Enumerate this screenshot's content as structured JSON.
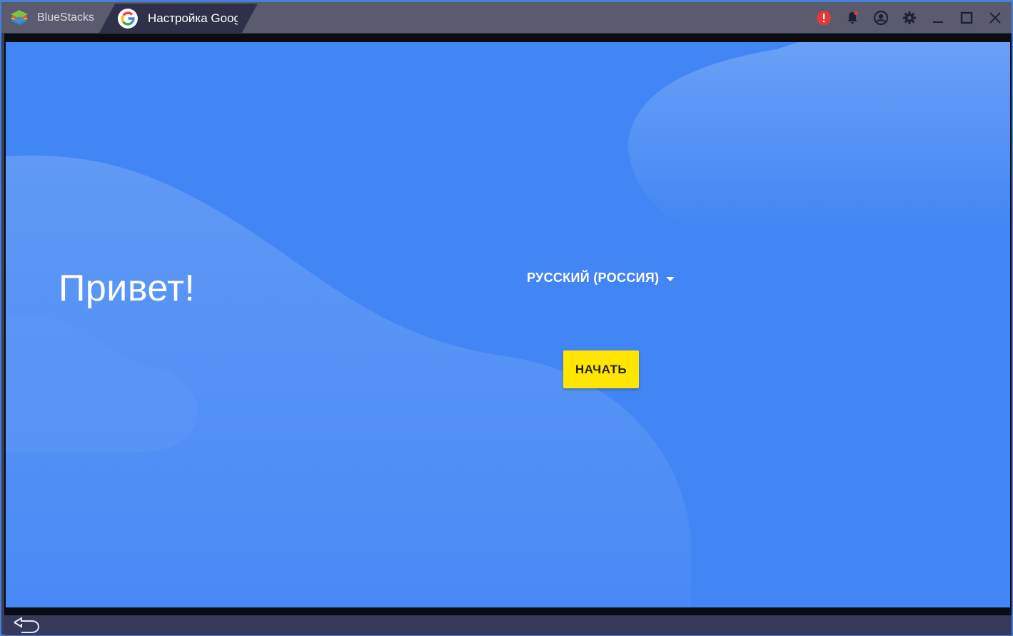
{
  "titlebar": {
    "home_tab_label": "BlueStacks",
    "active_tab_label": "Настройка Google",
    "icons": [
      "alert-icon",
      "bell-icon",
      "account-icon",
      "gear-icon",
      "minimize-icon",
      "maximize-icon",
      "close-icon"
    ]
  },
  "colors": {
    "accent": "#4285f4",
    "button": "#ffe500",
    "alert": "#e53935"
  },
  "screen": {
    "greeting": "Привет!",
    "language": "РУССКИЙ (РОССИЯ)",
    "start_button": "НАЧАТЬ"
  }
}
